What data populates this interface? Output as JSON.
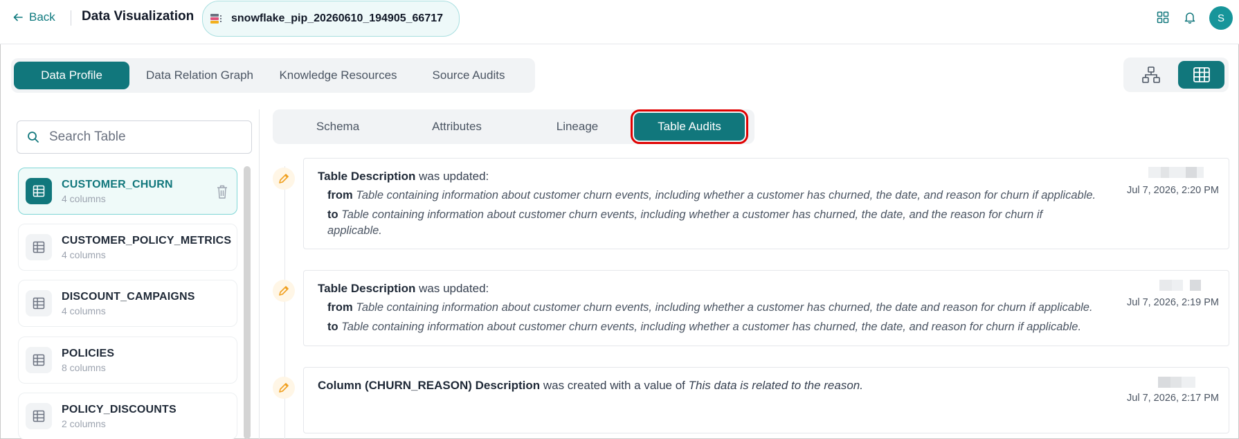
{
  "header": {
    "back_label": "Back",
    "title": "Data Visualization",
    "dataset": "snowflake_pip_20260610_194905_66717",
    "avatar_initial": "S",
    "accent": "#11777c"
  },
  "main_tabs": [
    {
      "label": "Data Profile",
      "active": true
    },
    {
      "label": "Data Relation Graph",
      "active": false
    },
    {
      "label": "Knowledge Resources",
      "active": false
    },
    {
      "label": "Source Audits",
      "active": false
    }
  ],
  "view_toggle": {
    "options": [
      "graph-view-icon",
      "table-view-icon"
    ],
    "active": "table-view-icon"
  },
  "search": {
    "placeholder": "Search Table"
  },
  "tables": [
    {
      "name": "CUSTOMER_CHURN",
      "columns": "4 columns",
      "active": true
    },
    {
      "name": "CUSTOMER_POLICY_METRICS",
      "columns": "4 columns",
      "active": false
    },
    {
      "name": "DISCOUNT_CAMPAIGNS",
      "columns": "4 columns",
      "active": false
    },
    {
      "name": "POLICIES",
      "columns": "8 columns",
      "active": false
    },
    {
      "name": "POLICY_DISCOUNTS",
      "columns": "2 columns",
      "active": false
    }
  ],
  "sub_tabs": [
    {
      "label": "Schema",
      "active": false
    },
    {
      "label": "Attributes",
      "active": false
    },
    {
      "label": "Lineage",
      "active": false
    },
    {
      "label": "Table Audits",
      "active": true
    }
  ],
  "audits": [
    {
      "subject": "Table Description",
      "action": " was updated:",
      "from_label": "from",
      "from": "Table containing information about customer churn events, including whether a customer has churned, the date, and reason for churn if applicable.",
      "to_label": "to",
      "to_line1": "Table containing information about customer churn events, including whether a customer has churned, the date, and the reason for churn if",
      "to_line2": "applicable.",
      "time": "Jul 7, 2026, 2:20 PM"
    },
    {
      "subject": "Table Description",
      "action": " was updated:",
      "from_label": "from",
      "from": "Table containing information about customer churn events, including whether a customer has churned, the date and reason for churn if applicable.",
      "to_label": "to",
      "to": "Table containing information about customer churn events, including whether a customer has churned, the date, and reason for churn if applicable.",
      "time": "Jul 7, 2026, 2:19 PM"
    },
    {
      "subject": "Column (CHURN_REASON) Description",
      "action": " was created with a value of ",
      "value": "This data is related to the reason.",
      "time": "Jul 7, 2026, 2:17 PM"
    }
  ]
}
